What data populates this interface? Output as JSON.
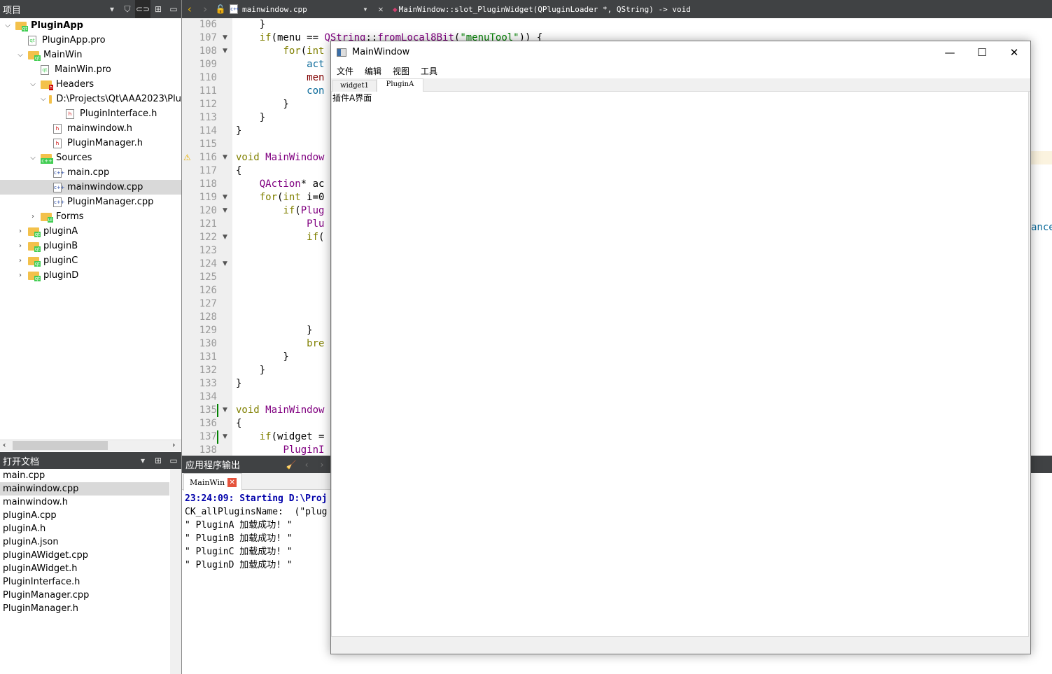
{
  "project_panel": {
    "title": "项目",
    "tree": [
      {
        "label": "PluginApp",
        "depth": 0,
        "expanded": true,
        "bold": true,
        "type": "qtfolder"
      },
      {
        "label": "PluginApp.pro",
        "depth": 1,
        "type": "pro"
      },
      {
        "label": "MainWin",
        "depth": 1,
        "expanded": true,
        "type": "qtfolder"
      },
      {
        "label": "MainWin.pro",
        "depth": 2,
        "type": "pro"
      },
      {
        "label": "Headers",
        "depth": 2,
        "expanded": true,
        "type": "hfolder"
      },
      {
        "label": "D:\\Projects\\Qt\\AAA2023\\Plu",
        "depth": 3,
        "expanded": true,
        "type": "folder"
      },
      {
        "label": "PluginInterface.h",
        "depth": 4,
        "type": "h"
      },
      {
        "label": "mainwindow.h",
        "depth": 3,
        "type": "h"
      },
      {
        "label": "PluginManager.h",
        "depth": 3,
        "type": "h"
      },
      {
        "label": "Sources",
        "depth": 2,
        "expanded": true,
        "type": "cfolder"
      },
      {
        "label": "main.cpp",
        "depth": 3,
        "type": "cpp"
      },
      {
        "label": "mainwindow.cpp",
        "depth": 3,
        "type": "cpp",
        "selected": true
      },
      {
        "label": "PluginManager.cpp",
        "depth": 3,
        "type": "cpp"
      },
      {
        "label": "Forms",
        "depth": 2,
        "expanded": false,
        "type": "ffolder"
      },
      {
        "label": "pluginA",
        "depth": 1,
        "expanded": false,
        "type": "qtfolder"
      },
      {
        "label": "pluginB",
        "depth": 1,
        "expanded": false,
        "type": "qtfolder"
      },
      {
        "label": "pluginC",
        "depth": 1,
        "expanded": false,
        "type": "qtfolder"
      },
      {
        "label": "pluginD",
        "depth": 1,
        "expanded": false,
        "type": "qtfolder"
      }
    ]
  },
  "open_docs": {
    "title": "打开文档",
    "items": [
      "main.cpp",
      "mainwindow.cpp",
      "mainwindow.h",
      "pluginA.cpp",
      "pluginA.h",
      "pluginA.json",
      "pluginAWidget.cpp",
      "pluginAWidget.h",
      "PluginInterface.h",
      "PluginManager.cpp",
      "PluginManager.h"
    ],
    "selected": 1
  },
  "editor": {
    "file": "mainwindow.cpp",
    "function": "MainWindow::slot_PluginWidget(QPluginLoader *, QString) -> void",
    "overflow_text": "ance",
    "lines": [
      {
        "n": 106,
        "code": [
          [
            "    }",
            "p"
          ]
        ]
      },
      {
        "n": 107,
        "fold": true,
        "code": [
          [
            "    ",
            "p"
          ],
          [
            "if",
            "k"
          ],
          [
            "(menu == ",
            "p"
          ],
          [
            "QString",
            "f"
          ],
          [
            "::",
            "p"
          ],
          [
            "fromLocal8Bit",
            "f"
          ],
          [
            "(",
            "p"
          ],
          [
            "\"menuTool\"",
            "s"
          ],
          [
            ")) {",
            "p"
          ]
        ]
      },
      {
        "n": 108,
        "fold": true,
        "code": [
          [
            "        ",
            "p"
          ],
          [
            "for",
            "k"
          ],
          [
            "(",
            "p"
          ],
          [
            "int",
            "k"
          ]
        ]
      },
      {
        "n": 109,
        "code": [
          [
            "            ",
            "p"
          ],
          [
            "act",
            "b"
          ]
        ]
      },
      {
        "n": 110,
        "code": [
          [
            "            ",
            "p"
          ],
          [
            "men",
            "v"
          ]
        ]
      },
      {
        "n": 111,
        "code": [
          [
            "            ",
            "p"
          ],
          [
            "con",
            "b"
          ]
        ]
      },
      {
        "n": 112,
        "code": [
          [
            "        }",
            "p"
          ]
        ]
      },
      {
        "n": 113,
        "code": [
          [
            "    }",
            "p"
          ]
        ]
      },
      {
        "n": 114,
        "code": [
          [
            "}",
            "p"
          ]
        ]
      },
      {
        "n": 115,
        "code": []
      },
      {
        "n": 116,
        "fold": true,
        "warning": true,
        "code": [
          [
            "void",
            "k"
          ],
          [
            " ",
            "p"
          ],
          [
            "MainWindow",
            "f"
          ]
        ]
      },
      {
        "n": 117,
        "code": [
          [
            "{",
            "p"
          ]
        ]
      },
      {
        "n": 118,
        "code": [
          [
            "    ",
            "p"
          ],
          [
            "QAction",
            "f"
          ],
          [
            "* ac",
            "p"
          ]
        ]
      },
      {
        "n": 119,
        "fold": true,
        "code": [
          [
            "    ",
            "p"
          ],
          [
            "for",
            "k"
          ],
          [
            "(",
            "p"
          ],
          [
            "int",
            "k"
          ],
          [
            " i=0",
            "p"
          ]
        ]
      },
      {
        "n": 120,
        "fold": true,
        "code": [
          [
            "        ",
            "p"
          ],
          [
            "if",
            "k"
          ],
          [
            "(",
            "p"
          ],
          [
            "Plug",
            "f"
          ]
        ]
      },
      {
        "n": 121,
        "code": [
          [
            "            ",
            "p"
          ],
          [
            "Plu",
            "f"
          ]
        ]
      },
      {
        "n": 122,
        "fold": true,
        "code": [
          [
            "            ",
            "p"
          ],
          [
            "if",
            "k"
          ],
          [
            "(",
            "p"
          ]
        ]
      },
      {
        "n": 123,
        "code": []
      },
      {
        "n": 124,
        "fold": true,
        "code": []
      },
      {
        "n": 125,
        "code": []
      },
      {
        "n": 126,
        "code": []
      },
      {
        "n": 127,
        "code": []
      },
      {
        "n": 128,
        "code": []
      },
      {
        "n": 129,
        "code": [
          [
            "            }",
            "p"
          ]
        ]
      },
      {
        "n": 130,
        "code": [
          [
            "            ",
            "p"
          ],
          [
            "bre",
            "k"
          ]
        ]
      },
      {
        "n": 131,
        "code": [
          [
            "        }",
            "p"
          ]
        ]
      },
      {
        "n": 132,
        "code": [
          [
            "    }",
            "p"
          ]
        ]
      },
      {
        "n": 133,
        "code": [
          [
            "}",
            "p"
          ]
        ]
      },
      {
        "n": 134,
        "code": []
      },
      {
        "n": 135,
        "fold": true,
        "changed": true,
        "code": [
          [
            "void",
            "k"
          ],
          [
            " ",
            "p"
          ],
          [
            "MainWindow",
            "f"
          ]
        ]
      },
      {
        "n": 136,
        "code": [
          [
            "{",
            "p"
          ]
        ]
      },
      {
        "n": 137,
        "fold": true,
        "changed": true,
        "code": [
          [
            "    ",
            "p"
          ],
          [
            "if",
            "k"
          ],
          [
            "(widget =",
            "p"
          ]
        ]
      },
      {
        "n": 138,
        "code": [
          [
            "        ",
            "p"
          ],
          [
            "PluginI",
            "f"
          ]
        ]
      }
    ]
  },
  "output": {
    "title": "应用程序输出",
    "tab": "MainWin",
    "lines": [
      {
        "text": "23:24:09: Starting D:\\Proj",
        "style": "start"
      },
      {
        "text": "CK_allPluginsName:  (\"plug",
        "style": "normal"
      },
      {
        "text": "\" PluginA 加载成功! \"",
        "style": "normal"
      },
      {
        "text": "\" PluginB 加载成功! \"",
        "style": "normal"
      },
      {
        "text": "\" PluginC 加载成功! \"",
        "style": "normal"
      },
      {
        "text": "\" PluginD 加载成功! \"",
        "style": "normal"
      }
    ]
  },
  "app_window": {
    "title": "MainWindow",
    "menus": [
      "文件",
      "编辑",
      "视图",
      "工具"
    ],
    "tabs": [
      "widget1",
      "PluginA"
    ],
    "active_tab": 1,
    "content": "插件A界面"
  },
  "colors": {
    "dark_bar": "#404244",
    "keyword": "#808000",
    "type": "#800080",
    "string": "#008000",
    "start_output": "#0000aa",
    "warning": "#e8b100",
    "changed": "#008000"
  }
}
